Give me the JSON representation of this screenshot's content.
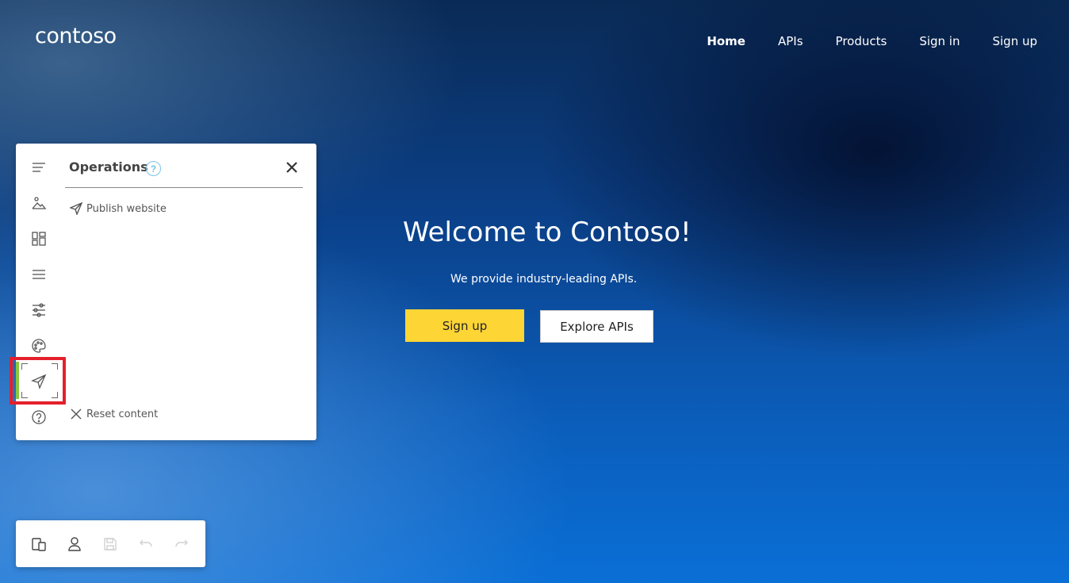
{
  "header": {
    "logo": "contoso",
    "nav": [
      {
        "label": "Home"
      },
      {
        "label": "APIs"
      },
      {
        "label": "Products"
      },
      {
        "label": "Sign in"
      },
      {
        "label": "Sign up"
      }
    ]
  },
  "hero": {
    "title": "Welcome to Contoso!",
    "subtitle": "We provide industry-leading APIs.",
    "primary_button": "Sign up",
    "secondary_button": "Explore APIs"
  },
  "panel": {
    "title": "Operations",
    "help_glyph": "?",
    "operations": [
      {
        "label": "Publish website",
        "icon": "send-icon"
      }
    ],
    "footer_action": {
      "label": "Reset content",
      "icon": "close-icon"
    }
  },
  "toolbar": {
    "items": [
      {
        "icon": "text-lines-icon"
      },
      {
        "icon": "image-icon"
      },
      {
        "icon": "layout-icon"
      },
      {
        "icon": "menu-icon"
      },
      {
        "icon": "settings-sliders-icon"
      },
      {
        "icon": "palette-icon"
      },
      {
        "icon": "send-icon",
        "active": true
      },
      {
        "icon": "help-icon"
      }
    ]
  },
  "bottom_bar": {
    "items": [
      {
        "icon": "devices-icon"
      },
      {
        "icon": "user-icon"
      },
      {
        "icon": "save-icon",
        "disabled": true
      },
      {
        "icon": "undo-icon",
        "disabled": true
      },
      {
        "icon": "redo-icon",
        "disabled": true
      }
    ]
  },
  "colors": {
    "accent_yellow": "#fdd535",
    "active_marker": "#8cc63f",
    "highlight": "#e3202b",
    "help_blue": "#7cc4e8"
  }
}
